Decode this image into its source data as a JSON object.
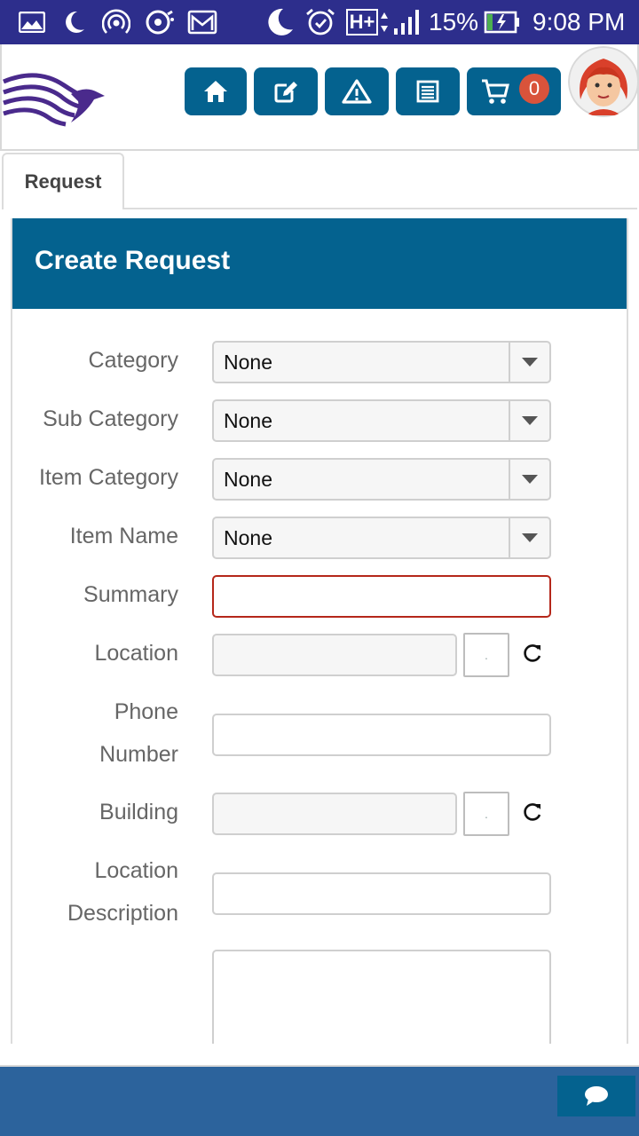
{
  "status_bar": {
    "battery_percent": "15%",
    "time": "9:08 PM",
    "network": "H+",
    "icons": [
      "gallery-icon",
      "moon-icon",
      "hotspot-icon",
      "nfc-icon",
      "gmail-icon",
      "do-not-disturb-icon",
      "alarm-icon",
      "network-type-icon",
      "signal-icon",
      "battery-charging-icon"
    ]
  },
  "header": {
    "logo": "eagle-logo-icon",
    "nav": [
      {
        "name": "home",
        "icon": "home-icon"
      },
      {
        "name": "edit",
        "icon": "edit-icon"
      },
      {
        "name": "alert",
        "icon": "warning-triangle-icon"
      },
      {
        "name": "list",
        "icon": "list-icon"
      },
      {
        "name": "cart",
        "icon": "cart-icon"
      }
    ],
    "cart_count": "0",
    "avatar": "user-avatar-icon"
  },
  "tabs": [
    {
      "label": "Request",
      "active": true
    }
  ],
  "form": {
    "title": "Create Request",
    "fields": {
      "category": {
        "label": "Category",
        "value": "None"
      },
      "sub_category": {
        "label": "Sub Category",
        "value": "None"
      },
      "item_category": {
        "label": "Item Category",
        "value": "None"
      },
      "item_name": {
        "label": "Item Name",
        "value": "None"
      },
      "summary": {
        "label": "Summary",
        "value": ""
      },
      "location": {
        "label": "Location",
        "value": ""
      },
      "phone_number": {
        "label_line1": "Phone",
        "label_line2": "Number",
        "value": ""
      },
      "building": {
        "label": "Building",
        "value": ""
      },
      "location_description": {
        "label_line1": "Location",
        "label_line2": "Description",
        "value": ""
      },
      "picker_text": "."
    }
  },
  "footer": {
    "chat_icon": "chat-icon"
  },
  "colors": {
    "status_bar": "#2d2e8c",
    "primary": "#04628f",
    "footer": "#2c639c",
    "badge": "#d9533b",
    "error_border": "#b5271a"
  }
}
